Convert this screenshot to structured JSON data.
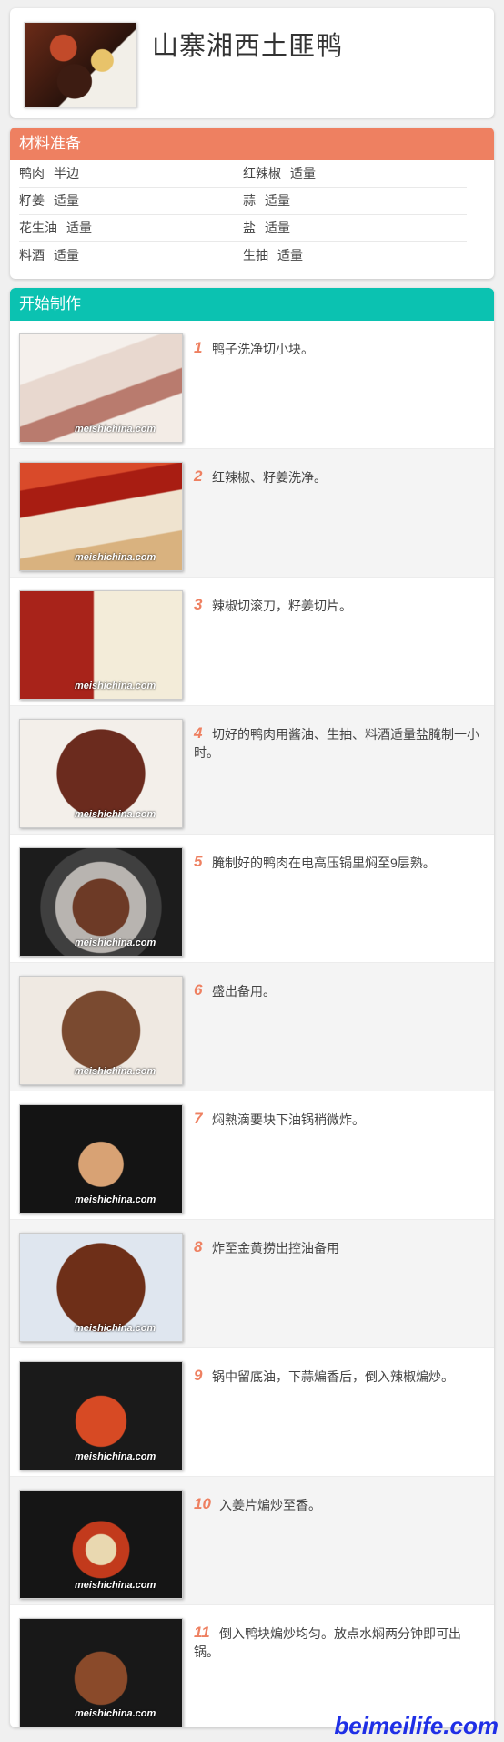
{
  "recipe": {
    "title": "山寨湘西土匪鸭"
  },
  "ingredients": {
    "header": "材料准备",
    "rows": [
      [
        {
          "name": "鸭肉",
          "amount": "半边"
        },
        {
          "name": "红辣椒",
          "amount": "适量"
        }
      ],
      [
        {
          "name": "籽姜",
          "amount": "适量"
        },
        {
          "name": "蒜",
          "amount": "适量"
        }
      ],
      [
        {
          "name": "花生油",
          "amount": "适量"
        },
        {
          "name": "盐",
          "amount": "适量"
        }
      ],
      [
        {
          "name": "料酒",
          "amount": "适量"
        },
        {
          "name": "生抽",
          "amount": "适量"
        }
      ]
    ]
  },
  "steps": {
    "header": "开始制作",
    "watermark_text": "meishichina.com",
    "items": [
      {
        "num": "1",
        "text": "鸭子洗净切小块。"
      },
      {
        "num": "2",
        "text": "红辣椒、籽姜洗净。"
      },
      {
        "num": "3",
        "text": "辣椒切滚刀，籽姜切片。"
      },
      {
        "num": "4",
        "text": "切好的鸭肉用酱油、生抽、料酒适量盐腌制一小时。"
      },
      {
        "num": "5",
        "text": "腌制好的鸭肉在电高压锅里焖至9层熟。"
      },
      {
        "num": "6",
        "text": "盛出备用。"
      },
      {
        "num": "7",
        "text": "焖熟滴要块下油锅稍微炸。"
      },
      {
        "num": "8",
        "text": "炸至金黄捞出控油备用"
      },
      {
        "num": "9",
        "text": "锅中留底油，下蒜煸香后，倒入辣椒煸炒。"
      },
      {
        "num": "10",
        "text": "入姜片煸炒至香。"
      },
      {
        "num": "11",
        "text": "倒入鸭块煸炒均匀。放点水焖两分钟即可出锅。"
      }
    ]
  },
  "site_watermark": "beimeilife.com"
}
